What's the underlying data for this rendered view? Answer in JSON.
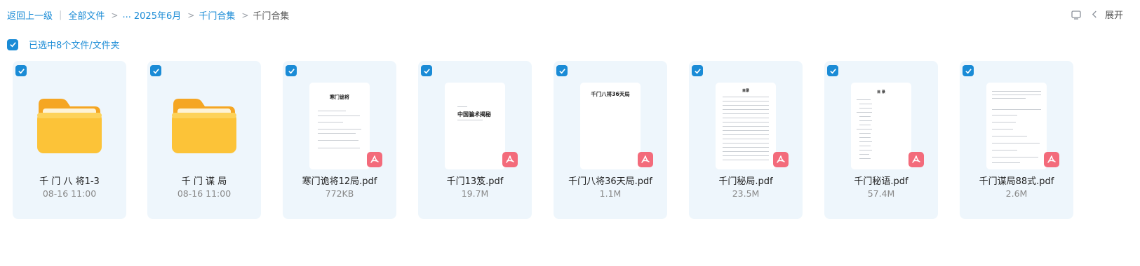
{
  "breadcrumb": {
    "back": "返回上一级",
    "all_files": "全部文件",
    "ellipsis": "...",
    "month": "2025年6月",
    "parent": "千门合集",
    "current": "千门合集"
  },
  "top_right": {
    "expand_label": "展开"
  },
  "selection": {
    "text": "已选中8个文件/文件夹"
  },
  "files": [
    {
      "name": "千 门 八 将1-3",
      "meta": "08-16 11:00",
      "type": "folder"
    },
    {
      "name": "千 门 谋 局",
      "meta": "08-16 11:00",
      "type": "folder"
    },
    {
      "name": "寒门诡将12局.pdf",
      "meta": "772KB",
      "type": "pdf",
      "doc_title": "寒门诡将"
    },
    {
      "name": "千门13笈.pdf",
      "meta": "19.7M",
      "type": "pdf",
      "doc_title": "中国骗术揭秘"
    },
    {
      "name": "千门八将36天局.pdf",
      "meta": "1.1M",
      "type": "pdf",
      "doc_title": "千门八将36天局"
    },
    {
      "name": "千门秘局.pdf",
      "meta": "23.5M",
      "type": "pdf",
      "doc_title": "目录"
    },
    {
      "name": "千门秘语.pdf",
      "meta": "57.4M",
      "type": "pdf",
      "doc_title": "目 录"
    },
    {
      "name": "千门谋局88式.pdf",
      "meta": "2.6M",
      "type": "pdf",
      "doc_title": ""
    }
  ],
  "colors": {
    "accent": "#1a8bd6",
    "card_bg": "#eef6fc",
    "pdf_badge": "#f36b7b",
    "folder": "#fbbf24"
  },
  "icons": {
    "checkbox": "check-icon",
    "folder": "folder-icon",
    "pdf": "pdf-icon",
    "monitor": "monitor-icon",
    "chevron": "chevron-left-icon"
  }
}
